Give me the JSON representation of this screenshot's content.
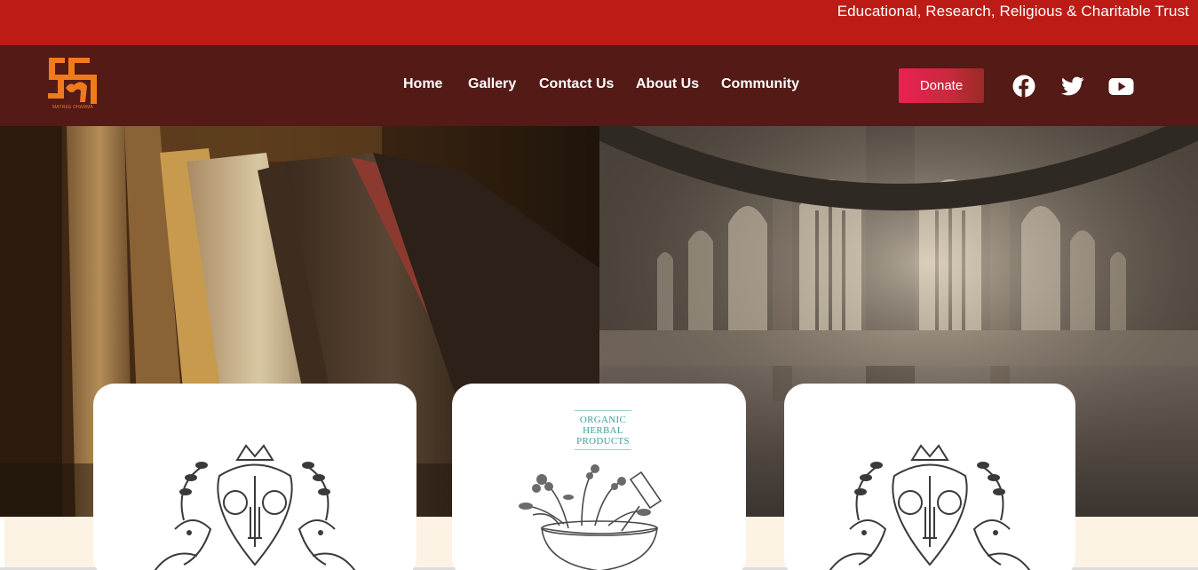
{
  "topbar": {
    "tagline": "Educational, Research, Religious & Charitable Trust"
  },
  "header": {
    "logo_text": "MATREE DHARMA",
    "nav": {
      "home": "Home",
      "gallery": "Gallery",
      "contact": "Contact Us",
      "about": "About Us",
      "community": "Community"
    },
    "donate_label": "Donate",
    "social": [
      "facebook-icon",
      "twitter-icon",
      "youtube-icon"
    ]
  },
  "hero": {
    "left_image": "old-books-photo",
    "right_image": "cathedral-cloister-photo"
  },
  "cards": {
    "card1": {
      "image": "emblem-crest-with-peacocks"
    },
    "card2": {
      "label": "ORGANIC HERBAL PRODUCTS",
      "image": "herbs-in-mortar-sketch"
    },
    "card3": {
      "image": "emblem-crest-with-peacocks"
    }
  },
  "colors": {
    "topbar": "#bd1b15",
    "header": "#531a16",
    "logo": "#f07a1e",
    "donate": "#ea2153",
    "cream": "#fdf3e4"
  }
}
